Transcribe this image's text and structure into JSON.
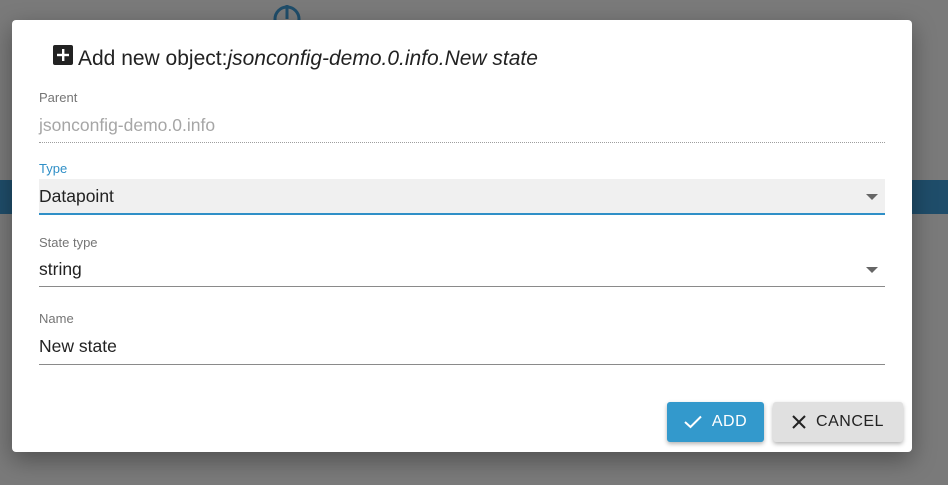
{
  "dialog": {
    "title_prefix": "Add new object: ",
    "title_object": "jsonconfig-demo.0.info.New state"
  },
  "fields": {
    "parent": {
      "label": "Parent",
      "value": "jsonconfig-demo.0.info"
    },
    "type": {
      "label": "Type",
      "value": "Datapoint"
    },
    "state_type": {
      "label": "State type",
      "value": "string"
    },
    "name": {
      "label": "Name",
      "value": "New state"
    }
  },
  "buttons": {
    "add": "ADD",
    "cancel": "CANCEL"
  },
  "icons": {
    "title": "plus-box-icon",
    "add": "check-icon",
    "cancel": "close-icon"
  },
  "colors": {
    "accent": "#3399cc",
    "focus": "#2f8fc7",
    "background_bar": "#1f4d6a"
  }
}
